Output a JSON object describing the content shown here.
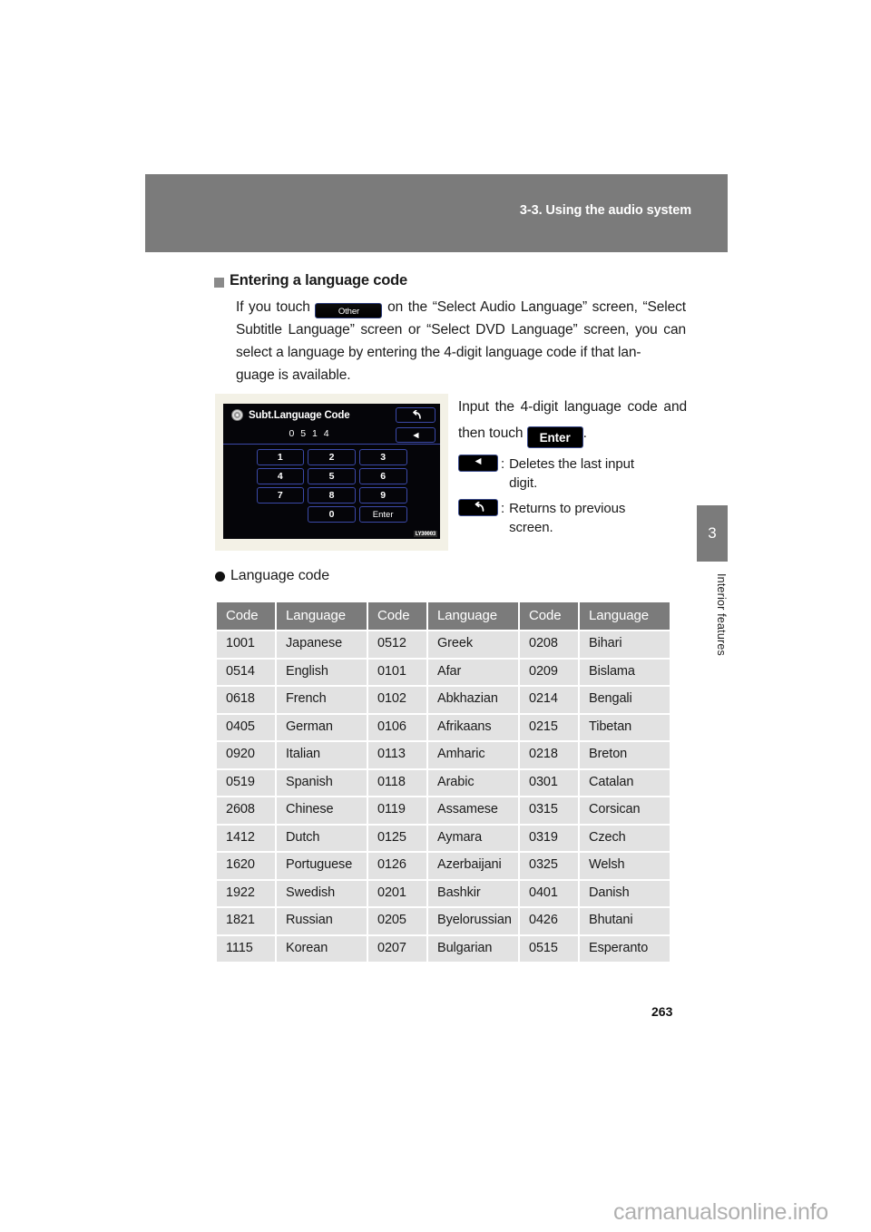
{
  "header": {
    "section_title": "3-3. Using the audio system"
  },
  "side_tab": {
    "chapter_number": "3",
    "chapter_label": "Interior features"
  },
  "section": {
    "heading": "Entering a language code",
    "paragraph_part1": "If you touch",
    "other_button_label": "Other",
    "paragraph_part2": "on the “Select Audio Language” screen, “Select Subtitle Language” screen or “Select DVD Language” screen, you can select a language by entering the 4-digit language code if that lan-",
    "paragraph_part3": "guage is available."
  },
  "figure": {
    "screen_title": "Subt.Language Code",
    "entered_code": "0 5 1 4",
    "return_icon": "↩",
    "back_icon": "◀",
    "keys": [
      "1",
      "2",
      "3",
      "4",
      "5",
      "6",
      "7",
      "8",
      "9",
      "",
      "0",
      "Enter"
    ],
    "figure_code": "LY30003",
    "disc_icon_name": "disc-icon"
  },
  "figure_text": {
    "line1": "Input the 4-digit language code and then touch",
    "enter_label": "Enter",
    "period": ".",
    "delete_icon": "◀",
    "delete_desc": "Deletes the last input",
    "delete_desc_last": "digit.",
    "return_icon": "↩",
    "return_desc": "Returns to previous",
    "return_desc_last": "screen."
  },
  "language_code_section": {
    "heading": "Language code",
    "table": {
      "headers": [
        "Code",
        "Language",
        "Code",
        "Language",
        "Code",
        "Language"
      ],
      "rows": [
        [
          "1001",
          "Japanese",
          "0512",
          "Greek",
          "0208",
          "Bihari"
        ],
        [
          "0514",
          "English",
          "0101",
          "Afar",
          "0209",
          "Bislama"
        ],
        [
          "0618",
          "French",
          "0102",
          "Abkhazian",
          "0214",
          "Bengali"
        ],
        [
          "0405",
          "German",
          "0106",
          "Afrikaans",
          "0215",
          "Tibetan"
        ],
        [
          "0920",
          "Italian",
          "0113",
          "Amharic",
          "0218",
          "Breton"
        ],
        [
          "0519",
          "Spanish",
          "0118",
          "Arabic",
          "0301",
          "Catalan"
        ],
        [
          "2608",
          "Chinese",
          "0119",
          "Assamese",
          "0315",
          "Corsican"
        ],
        [
          "1412",
          "Dutch",
          "0125",
          "Aymara",
          "0319",
          "Czech"
        ],
        [
          "1620",
          "Portuguese",
          "0126",
          "Azerbaijani",
          "0325",
          "Welsh"
        ],
        [
          "1922",
          "Swedish",
          "0201",
          "Bashkir",
          "0401",
          "Danish"
        ],
        [
          "1821",
          "Russian",
          "0205",
          "Byelorussian",
          "0426",
          "Bhutani"
        ],
        [
          "1115",
          "Korean",
          "0207",
          "Bulgarian",
          "0515",
          "Esperanto"
        ]
      ]
    }
  },
  "footer": {
    "page_number": "263",
    "watermark": "carmanualsonline.info"
  },
  "colors": {
    "header_gray": "#7b7b7b",
    "table_header_gray": "#7b7b7b",
    "table_cell_gray": "#e2e2e2",
    "screen_black": "#050509",
    "screen_blue_border": "#3b49a8",
    "watermark_gray": "#b0b0b0"
  }
}
